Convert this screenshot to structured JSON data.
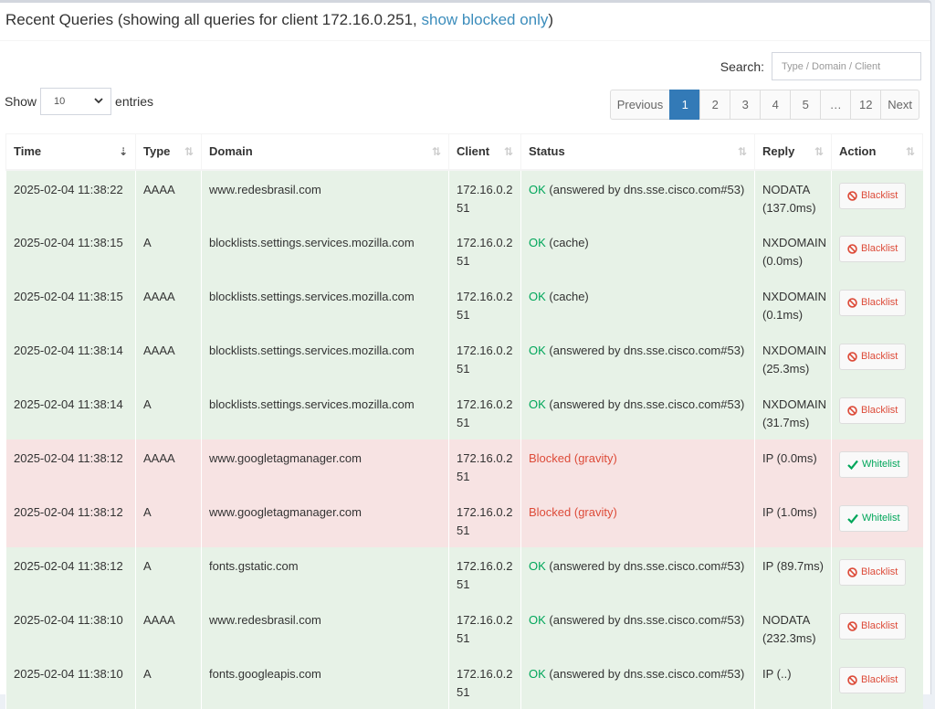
{
  "header": {
    "title_prefix": "Recent Queries (showing all queries for client 172.16.0.251, ",
    "link": "show blocked only",
    "title_suffix": ")"
  },
  "search": {
    "label": "Search:",
    "placeholder": "Type / Domain / Client"
  },
  "show": {
    "prefix": "Show",
    "value": "10",
    "suffix": "entries"
  },
  "pagination": [
    "Previous",
    "1",
    "2",
    "3",
    "4",
    "5",
    "…",
    "12",
    "Next"
  ],
  "pagination_active": "1",
  "columns": [
    "Time",
    "Type",
    "Domain",
    "Client",
    "Status",
    "Reply",
    "Action"
  ],
  "rows": [
    {
      "time": "2025-02-04 11:38:22",
      "type": "AAAA",
      "domain": "www.redesbrasil.com",
      "client": "172.16.0.251",
      "status_word": "OK",
      "status_detail": " (answered by dns.sse.cisco.com#53)",
      "blocked": false,
      "reply": "NODATA (137.0ms)",
      "action": "Blacklist"
    },
    {
      "time": "2025-02-04 11:38:15",
      "type": "A",
      "domain": "blocklists.settings.services.mozilla.com",
      "client": "172.16.0.251",
      "status_word": "OK",
      "status_detail": " (cache)",
      "blocked": false,
      "reply": "NXDOMAIN (0.0ms)",
      "action": "Blacklist"
    },
    {
      "time": "2025-02-04 11:38:15",
      "type": "AAAA",
      "domain": "blocklists.settings.services.mozilla.com",
      "client": "172.16.0.251",
      "status_word": "OK",
      "status_detail": " (cache)",
      "blocked": false,
      "reply": "NXDOMAIN (0.1ms)",
      "action": "Blacklist"
    },
    {
      "time": "2025-02-04 11:38:14",
      "type": "AAAA",
      "domain": "blocklists.settings.services.mozilla.com",
      "client": "172.16.0.251",
      "status_word": "OK",
      "status_detail": " (answered by dns.sse.cisco.com#53)",
      "blocked": false,
      "reply": "NXDOMAIN (25.3ms)",
      "action": "Blacklist"
    },
    {
      "time": "2025-02-04 11:38:14",
      "type": "A",
      "domain": "blocklists.settings.services.mozilla.com",
      "client": "172.16.0.251",
      "status_word": "OK",
      "status_detail": " (answered by dns.sse.cisco.com#53)",
      "blocked": false,
      "reply": "NXDOMAIN (31.7ms)",
      "action": "Blacklist"
    },
    {
      "time": "2025-02-04 11:38:12",
      "type": "AAAA",
      "domain": "www.googletagmanager.com",
      "client": "172.16.0.251",
      "status_word": "Blocked (gravity)",
      "status_detail": "",
      "blocked": true,
      "reply": "IP (0.0ms)",
      "action": "Whitelist"
    },
    {
      "time": "2025-02-04 11:38:12",
      "type": "A",
      "domain": "www.googletagmanager.com",
      "client": "172.16.0.251",
      "status_word": "Blocked (gravity)",
      "status_detail": "",
      "blocked": true,
      "reply": "IP (1.0ms)",
      "action": "Whitelist"
    },
    {
      "time": "2025-02-04 11:38:12",
      "type": "A",
      "domain": "fonts.gstatic.com",
      "client": "172.16.0.251",
      "status_word": "OK",
      "status_detail": " (answered by dns.sse.cisco.com#53)",
      "blocked": false,
      "reply": "IP (89.7ms)",
      "action": "Blacklist"
    },
    {
      "time": "2025-02-04 11:38:10",
      "type": "AAAA",
      "domain": "www.redesbrasil.com",
      "client": "172.16.0.251",
      "status_word": "OK",
      "status_detail": " (answered by dns.sse.cisco.com#53)",
      "blocked": false,
      "reply": "NODATA (232.3ms)",
      "action": "Blacklist"
    },
    {
      "time": "2025-02-04 11:38:10",
      "type": "A",
      "domain": "fonts.googleapis.com",
      "client": "172.16.0.251",
      "status_word": "OK",
      "status_detail": " (answered by dns.sse.cisco.com#53)",
      "blocked": false,
      "reply": "IP (..)",
      "action": "Blacklist"
    }
  ],
  "colors": {
    "ok_row": "#e7f2e7",
    "blocked_row": "#f7e3e3",
    "ok_text": "#00a65a",
    "blocked_text": "#dd4b39",
    "link": "#3c8dbc",
    "active_page": "#337ab7"
  }
}
